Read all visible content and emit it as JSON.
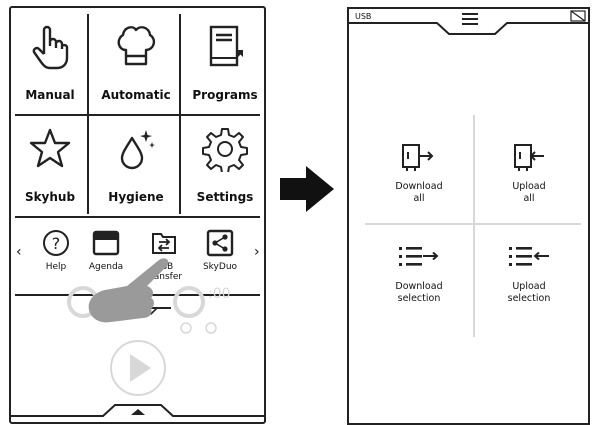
{
  "left_screen": {
    "main_tiles": [
      {
        "label": "Manual",
        "icon": "hand-pointer-icon"
      },
      {
        "label": "Automatic",
        "icon": "chef-hat-icon"
      },
      {
        "label": "Programs",
        "icon": "recipe-book-icon"
      },
      {
        "label": "Skyhub",
        "icon": "star-icon"
      },
      {
        "label": "Hygiene",
        "icon": "water-drop-sparkle-icon"
      },
      {
        "label": "Settings",
        "icon": "gear-icon"
      }
    ],
    "quick_access": [
      {
        "label": "Help",
        "icon": "help-icon"
      },
      {
        "label": "Agenda",
        "icon": "agenda-icon"
      },
      {
        "label": "USB\nTransfer",
        "icon": "usb-transfer-icon"
      },
      {
        "label": "SkyDuo",
        "icon": "share-icon"
      }
    ],
    "timer_text": ":00"
  },
  "right_screen": {
    "header_label": "USB",
    "options": [
      {
        "label": "Download\nall",
        "icon": "download-all-icon"
      },
      {
        "label": "Upload\nall",
        "icon": "upload-all-icon"
      },
      {
        "label": "Download\nselection",
        "icon": "download-selection-icon"
      },
      {
        "label": "Upload\nselection",
        "icon": "upload-selection-icon"
      }
    ]
  },
  "colors": {
    "line": "#222222",
    "ghost": "#d8d8d8",
    "hand": "#9a9a9a"
  }
}
